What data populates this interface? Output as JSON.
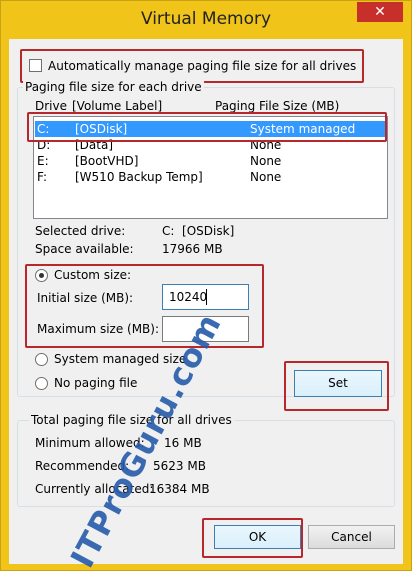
{
  "window": {
    "title": "Virtual Memory",
    "close_glyph": "✕"
  },
  "auto_manage": {
    "label": "Automatically manage paging file size for all drives",
    "checked": false
  },
  "paging_group": {
    "title": "Paging file size for each drive",
    "columns": [
      "Drive",
      "[Volume Label]",
      "Paging File Size (MB)"
    ],
    "drives": [
      {
        "drive": "C:",
        "label": "[OSDisk]",
        "size": "System managed",
        "selected": true
      },
      {
        "drive": "D:",
        "label": "[Data]",
        "size": "None",
        "selected": false
      },
      {
        "drive": "E:",
        "label": "[BootVHD]",
        "size": "None",
        "selected": false
      },
      {
        "drive": "F:",
        "label": "[W510 Backup Temp]",
        "size": "None",
        "selected": false
      }
    ],
    "selected_drive_label": "Selected drive:",
    "selected_drive_value": "C:  [OSDisk]",
    "space_available_label": "Space available:",
    "space_available_value": "17966 MB",
    "custom_size_label": "Custom size:",
    "initial_size_label": "Initial size (MB):",
    "initial_size_value": "10240",
    "maximum_size_label": "Maximum size (MB):",
    "maximum_size_value": "",
    "system_managed_label": "System managed size",
    "no_paging_label": "No paging file",
    "set_label": "Set",
    "selected_option": "custom"
  },
  "totals_group": {
    "title": "Total paging file size for all drives",
    "rows": [
      {
        "label": "Minimum allowed:",
        "value": "16 MB"
      },
      {
        "label": "Recommended:",
        "value": "5623 MB"
      },
      {
        "label": "Currently allocated:",
        "value": "16384 MB"
      }
    ]
  },
  "buttons": {
    "ok": "OK",
    "cancel": "Cancel"
  },
  "watermark": "ITProGuru.com",
  "colors": {
    "frame": "#f0c419",
    "highlight": "#b8272c",
    "selection": "#3399ff",
    "watermark": "#235aaa"
  }
}
